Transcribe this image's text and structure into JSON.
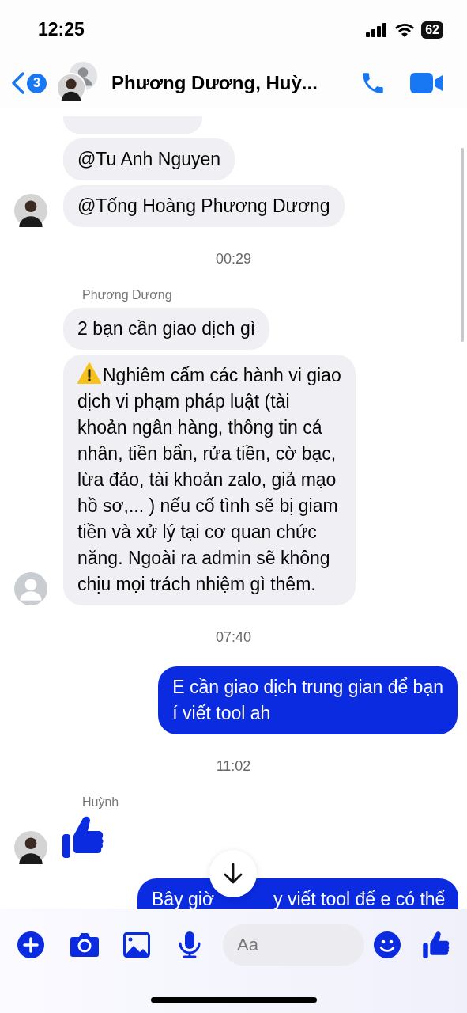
{
  "status_bar": {
    "time": "12:25",
    "battery": "62"
  },
  "header": {
    "back_badge": "3",
    "title": "Phương Dương, Huỳ..."
  },
  "messages": [
    {
      "kind": "sliver",
      "outgoing": false
    },
    {
      "kind": "bubble",
      "outgoing": false,
      "text": "@Tu Anh Nguyen"
    },
    {
      "kind": "bubble",
      "outgoing": false,
      "text": "@Tống Hoàng Phương Dương",
      "avatar": {
        "kind": "photo"
      }
    },
    {
      "kind": "time",
      "text": "00:29"
    },
    {
      "kind": "sender",
      "text": "Phương Dương"
    },
    {
      "kind": "bubble",
      "outgoing": false,
      "text": "2 bạn cần giao dịch gì"
    },
    {
      "kind": "bubble",
      "outgoing": false,
      "warning": true,
      "text": "Nghiêm cấm các hành vi giao\ndịch vi phạm pháp luật (tài\nkhoản ngân hàng, thông tin cá\nnhân, tiền bẩn, rửa tiền, cờ bạc,\nlừa đảo, tài khoản zalo, giả mạo\nhồ sơ,... ) nếu cố tình sẽ bị giam\ntiền và xử lý tại cơ quan chức\nnăng. Ngoài ra admin sẽ không\nchịu mọi trách nhiệm gì thêm.",
      "avatar": {
        "kind": "placeholder"
      }
    },
    {
      "kind": "time",
      "text": "07:40"
    },
    {
      "kind": "bubble",
      "outgoing": true,
      "text": "E cần giao dịch trung gian để bạn\ní viết tool ah"
    },
    {
      "kind": "time",
      "text": "11:02"
    },
    {
      "kind": "sender",
      "text": "Huỳnh"
    },
    {
      "kind": "like",
      "avatar": {
        "kind": "photo"
      }
    },
    {
      "kind": "cut",
      "outgoing": true,
      "parts": [
        "Bây giờ",
        "y viết tool để e có thể"
      ]
    }
  ],
  "composer": {
    "placeholder": "Aa"
  }
}
